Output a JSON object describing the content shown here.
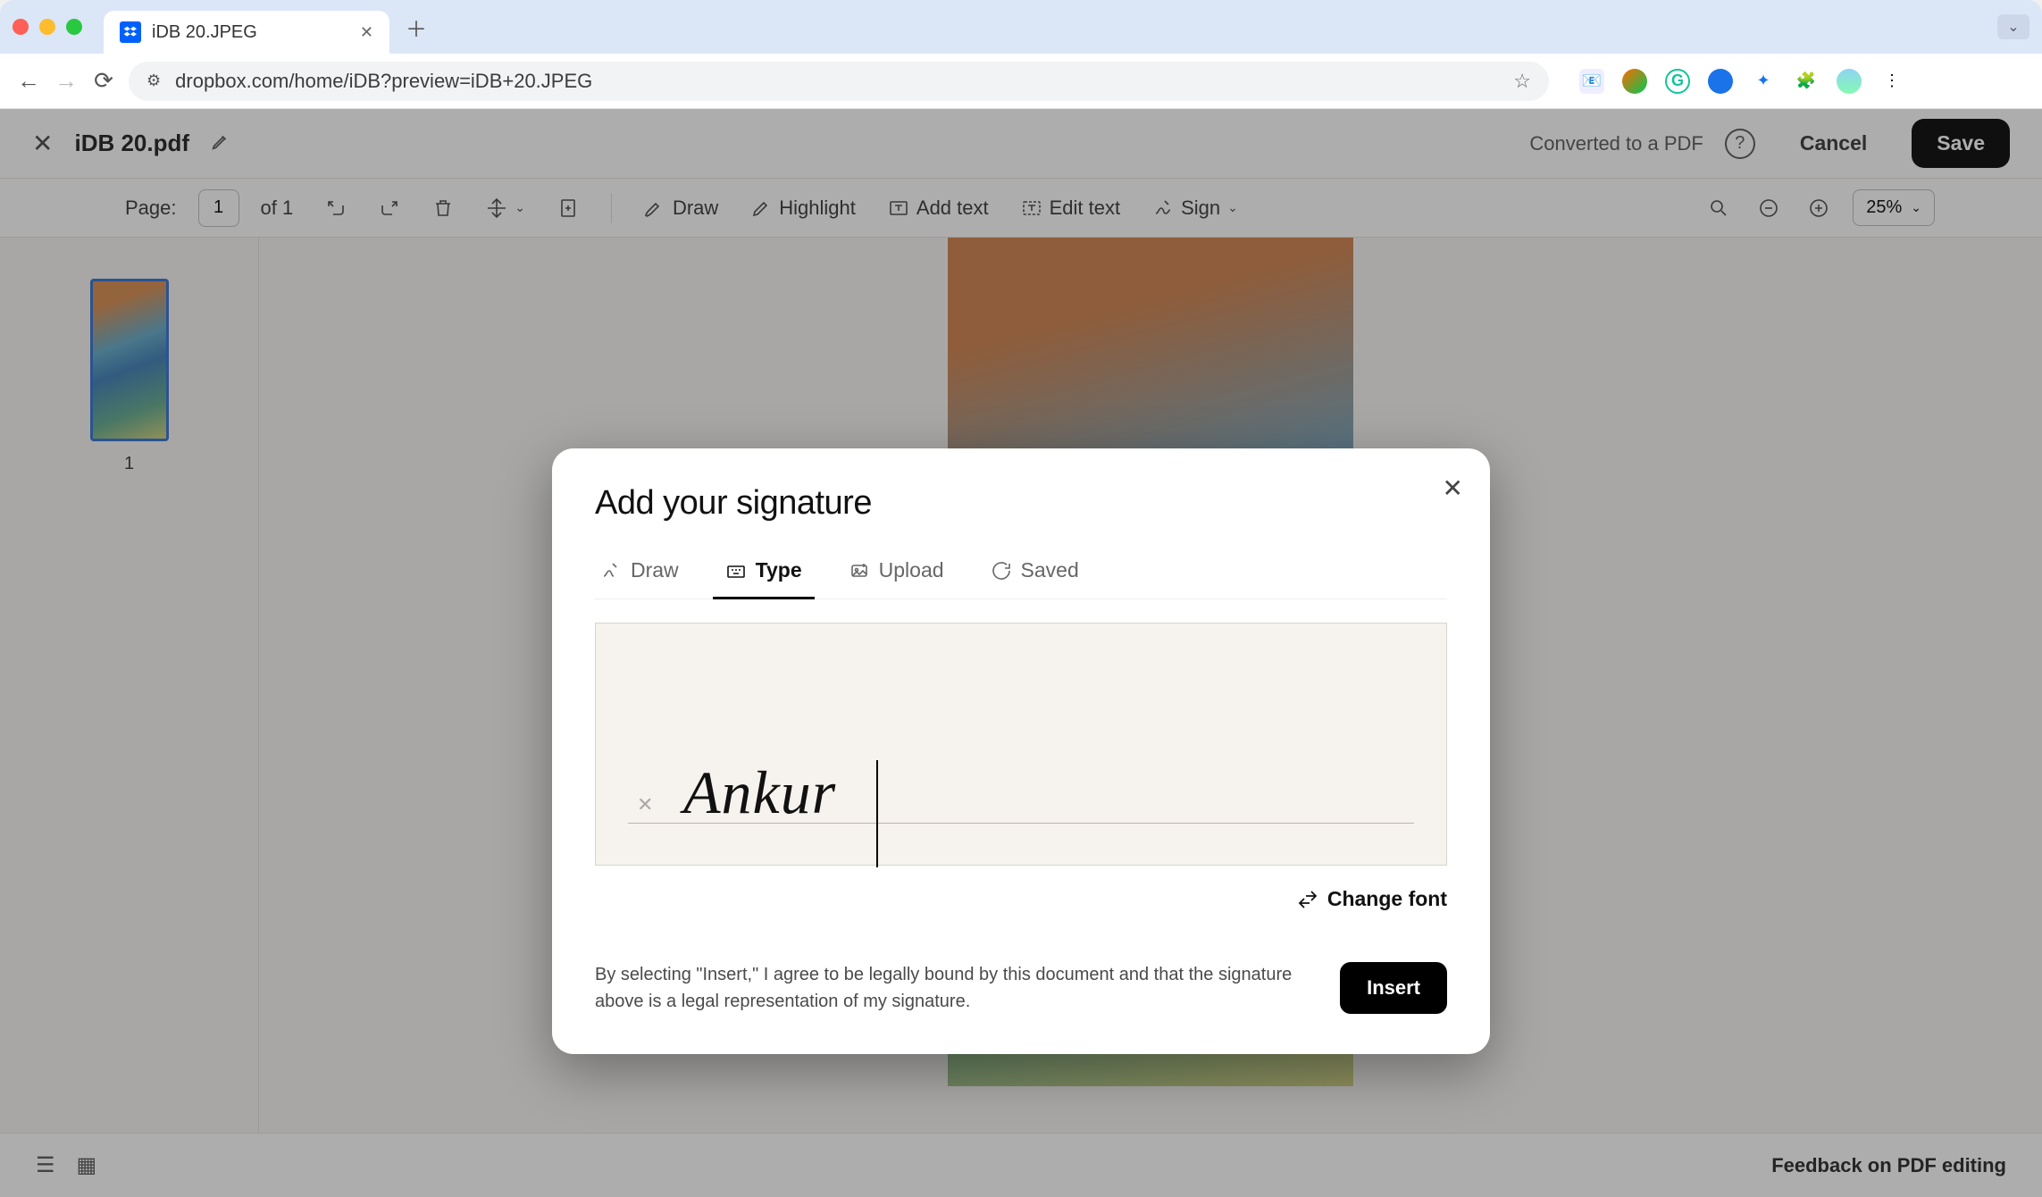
{
  "browser": {
    "tab_title": "iDB 20.JPEG",
    "url": "dropbox.com/home/iDB?preview=iDB+20.JPEG"
  },
  "header": {
    "file_name": "iDB 20.pdf",
    "converted": "Converted to a PDF",
    "cancel": "Cancel",
    "save": "Save"
  },
  "toolbar": {
    "page_label": "Page:",
    "page_value": "1",
    "of_pages": "of 1",
    "draw": "Draw",
    "highlight": "Highlight",
    "add_text": "Add text",
    "edit_text": "Edit text",
    "sign": "Sign",
    "zoom": "25%"
  },
  "thumbs": {
    "page1_num": "1"
  },
  "modal": {
    "title": "Add your signature",
    "tabs": {
      "draw": "Draw",
      "type": "Type",
      "upload": "Upload",
      "saved": "Saved"
    },
    "signature_text": "Ankur",
    "change_font": "Change font",
    "disclaimer": "By selecting \"Insert,\" I agree to be legally bound by this document and that the signature above is a legal representation of my signature.",
    "insert": "Insert"
  },
  "footer": {
    "feedback": "Feedback on PDF editing"
  }
}
